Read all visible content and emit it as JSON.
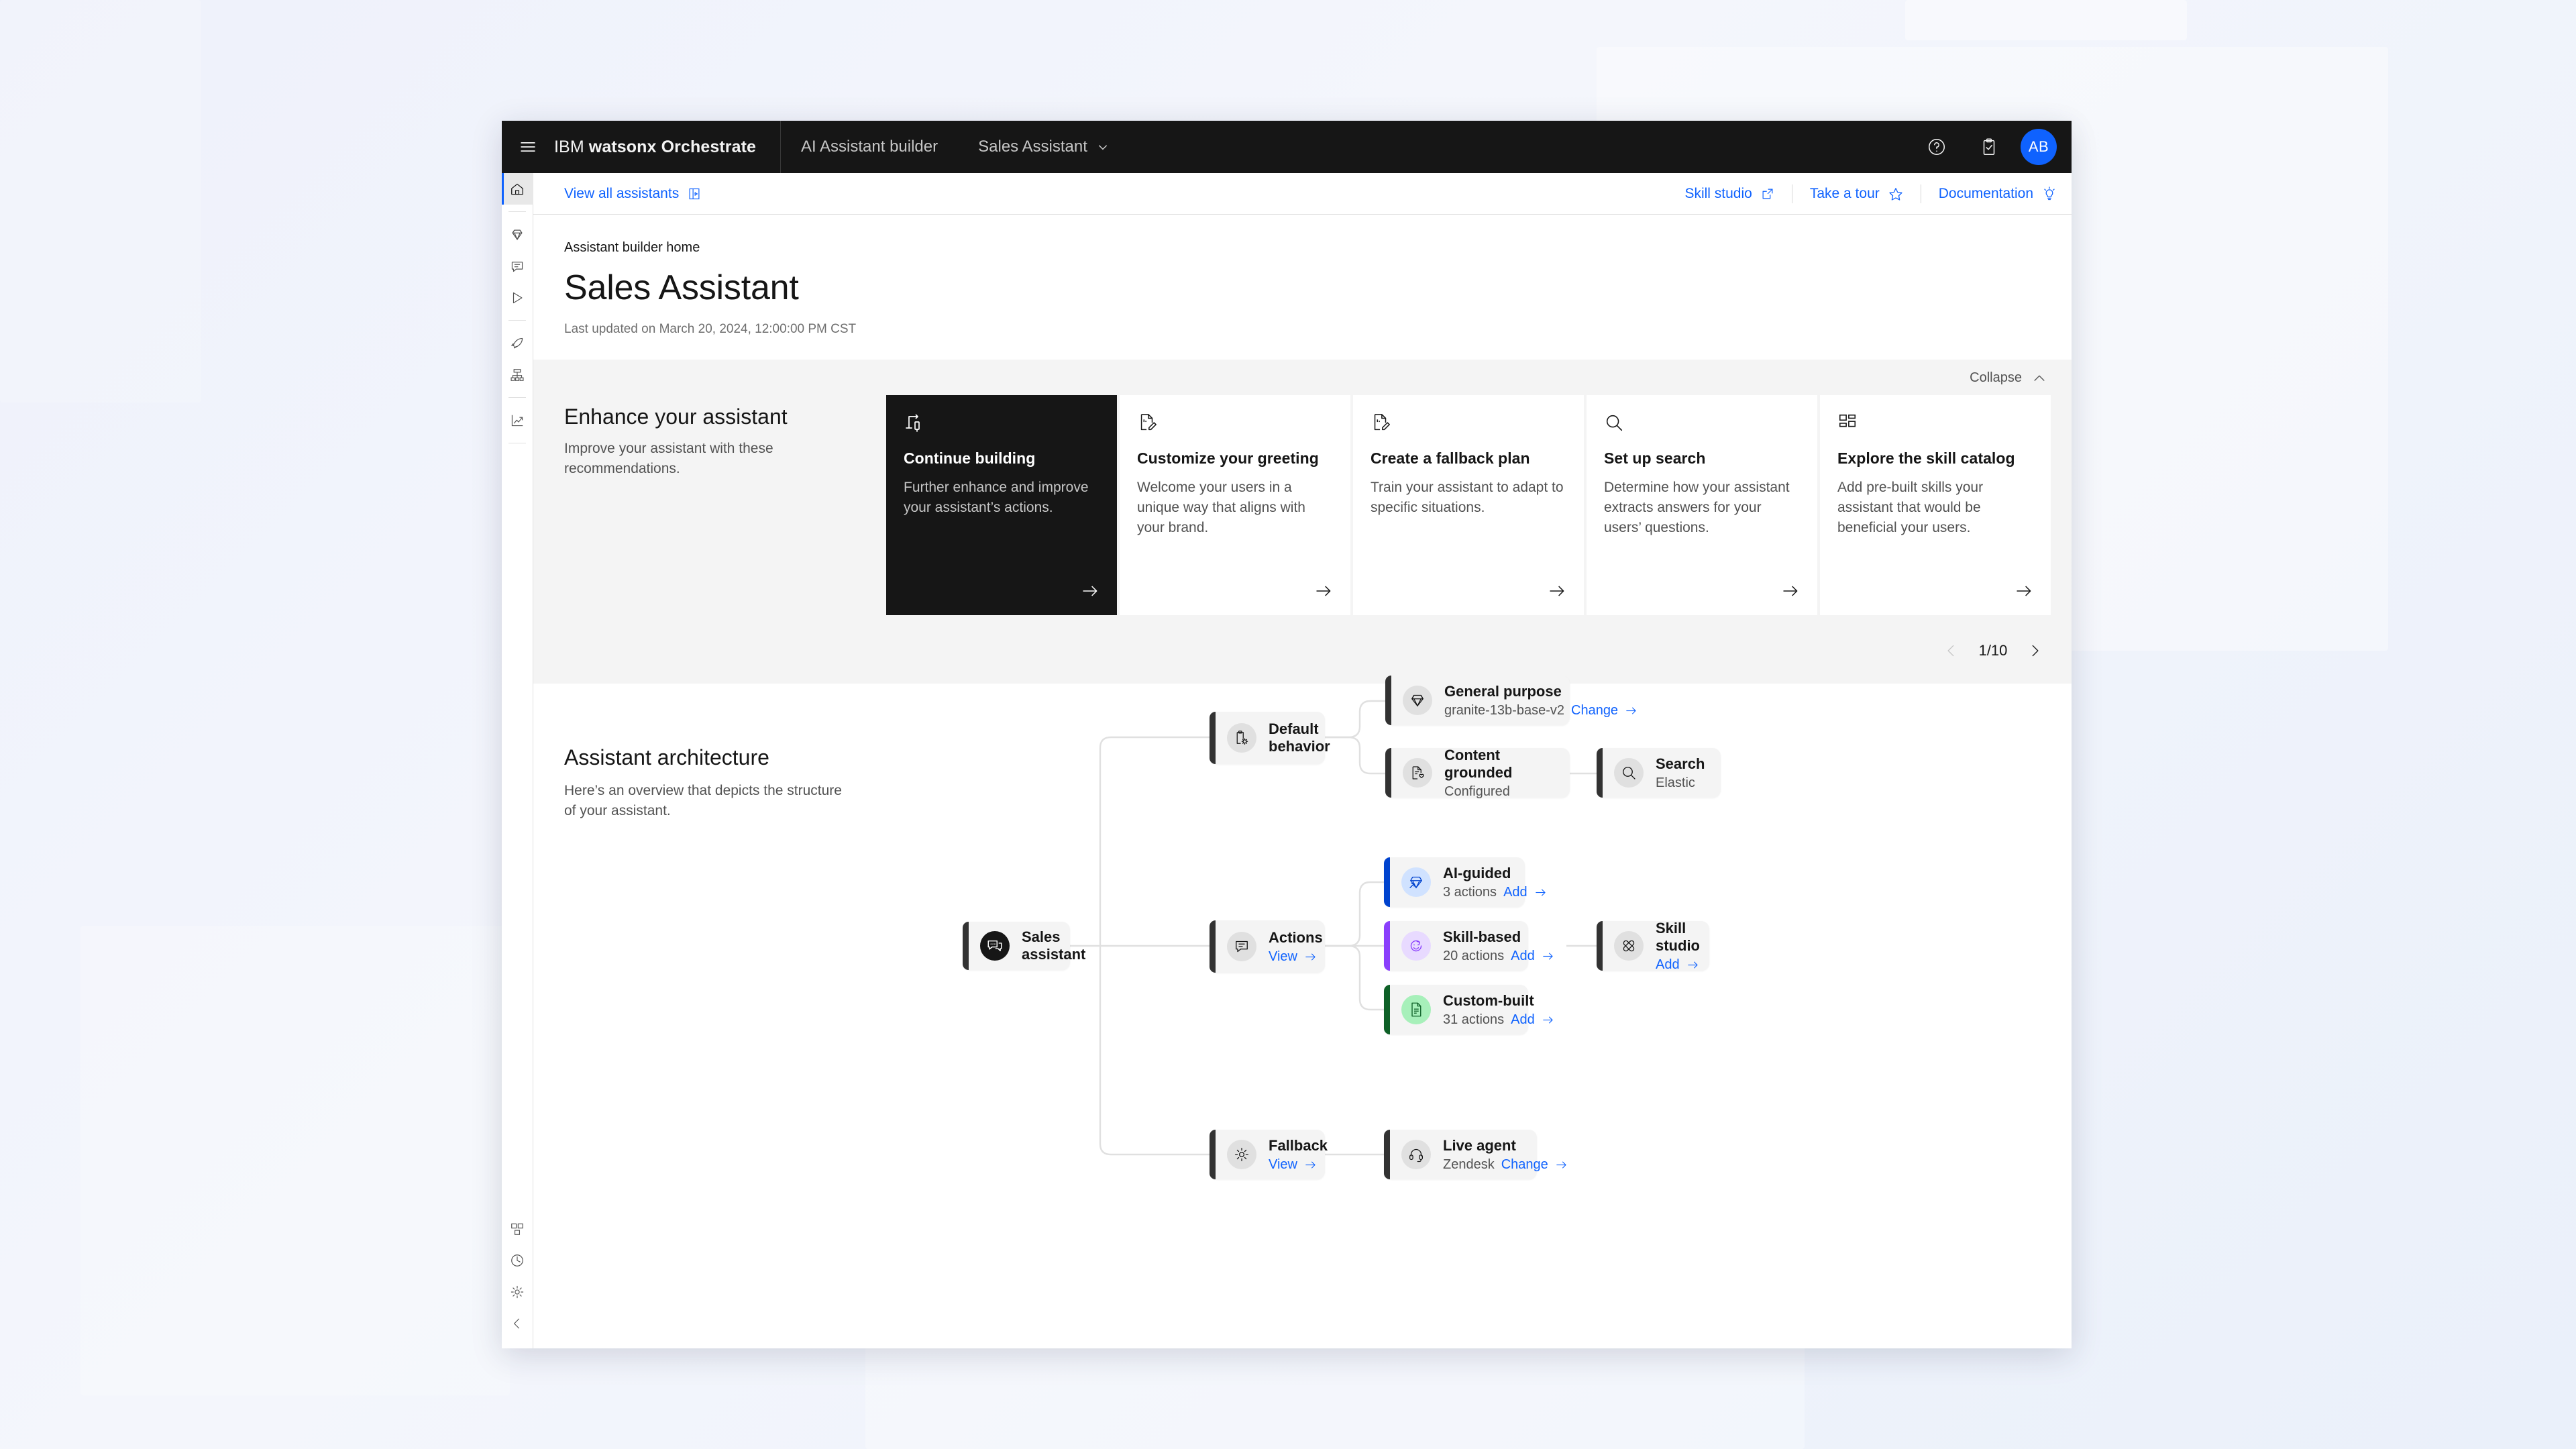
{
  "header": {
    "menu_icon": "hamburger-menu-icon",
    "brand_prefix": "IBM",
    "brand_name": "watsonx Orchestrate",
    "product": "AI Assistant builder",
    "assistant_selector": "Sales Assistant",
    "help_icon": "help-circle-icon",
    "tasks_icon": "clipboard-check-icon",
    "avatar_initials": "AB"
  },
  "rail": {
    "items": [
      {
        "name": "home",
        "icon": "home-icon",
        "active": true
      },
      {
        "name": "divider-1",
        "icon": "divider",
        "active": false
      },
      {
        "name": "diamond",
        "icon": "diamond-icon",
        "active": false
      },
      {
        "name": "chat",
        "icon": "chat-bubble-icon",
        "active": false
      },
      {
        "name": "preview",
        "icon": "play-triangle-icon",
        "active": false
      },
      {
        "name": "divider-2",
        "icon": "divider",
        "active": false
      },
      {
        "name": "deploy",
        "icon": "rocket-icon",
        "active": false
      },
      {
        "name": "integrate",
        "icon": "hierarchy-icon",
        "active": false
      },
      {
        "name": "divider-3",
        "icon": "divider",
        "active": false
      },
      {
        "name": "analytics",
        "icon": "chart-line-icon",
        "active": false
      },
      {
        "name": "divider-4",
        "icon": "divider",
        "active": false
      }
    ],
    "bottom_items": [
      {
        "name": "environments",
        "icon": "model-alt-icon"
      },
      {
        "name": "history",
        "icon": "clock-icon"
      },
      {
        "name": "settings",
        "icon": "gear-icon"
      },
      {
        "name": "collapse",
        "icon": "chevron-left-icon"
      }
    ]
  },
  "toolbar": {
    "view_all": "View all assistants",
    "view_all_icon": "launch-panel-icon",
    "skill_studio": "Skill studio",
    "skill_studio_icon": "external-link-icon",
    "take_a_tour": "Take a tour",
    "take_a_tour_icon": "star-icon",
    "documentation": "Documentation",
    "documentation_icon": "lightbulb-idea-icon"
  },
  "page": {
    "breadcrumb": "Assistant builder home",
    "title": "Sales Assistant",
    "last_updated": "Last updated on March 20, 2024, 12:00:00 PM CST"
  },
  "enhance": {
    "collapse_label": "Collapse",
    "collapse_icon": "chevron-up-icon",
    "heading": "Enhance your assistant",
    "description": "Improve your assistant with these recommendations.",
    "cards": [
      {
        "icon": "flow-connection-icon",
        "title": "Continue building",
        "description": "Further enhance and improve your assistant’s actions.",
        "dark": true
      },
      {
        "icon": "document-edit-icon",
        "title": "Customize your greeting",
        "description": "Welcome your users in a unique way that aligns with your brand.",
        "dark": false
      },
      {
        "icon": "document-edit-icon",
        "title": "Create a fallback plan",
        "description": "Train your assistant to adapt to specific situations.",
        "dark": false
      },
      {
        "icon": "search-icon",
        "title": "Set up search",
        "description": "Determine how your assistant extracts answers for your users’ questions.",
        "dark": false
      },
      {
        "icon": "grid-catalog-icon",
        "title": "Explore the skill catalog",
        "description": "Add pre-built skills your assistant that would be beneficial your users.",
        "dark": false
      }
    ],
    "pager": {
      "prev_icon": "chevron-left-icon",
      "next_icon": "chevron-right-icon",
      "label": "1/10"
    }
  },
  "architecture": {
    "heading": "Assistant architecture",
    "description": "Here’s an overview that depicts the structure of your assistant.",
    "nodes": {
      "root": {
        "title": "Sales assistant",
        "icon": "assistant-chat-icon",
        "sub": "",
        "link": "",
        "link_icon": ""
      },
      "default": {
        "title": "Default behavior",
        "icon": "clipboard-gear-icon",
        "sub": "",
        "link": "",
        "link_icon": ""
      },
      "general": {
        "title": "General purpose",
        "icon": "diamond-icon",
        "sub": "granite-13b-base-v2",
        "link": "Change",
        "link_icon": "arrow-right-icon"
      },
      "content": {
        "title": "Content grounded",
        "icon": "document-heart-icon",
        "sub": "Configured",
        "link": "",
        "link_icon": ""
      },
      "search": {
        "title": "Search",
        "icon": "search-icon",
        "sub": "Elastic",
        "link": "",
        "link_icon": ""
      },
      "actions": {
        "title": "Actions",
        "icon": "chat-bubble-icon",
        "sub": "",
        "link": "View",
        "link_icon": "arrow-right-icon"
      },
      "ai_guided": {
        "title": "AI-guided",
        "icon": "diamond-arrow-icon",
        "sub": "3 actions",
        "link": "Add",
        "link_icon": "arrow-right-icon"
      },
      "skill_based": {
        "title": "Skill-based",
        "icon": "skill-sync-icon",
        "sub": "20 actions",
        "link": "Add",
        "link_icon": "arrow-right-icon"
      },
      "custom_built": {
        "title": "Custom-built",
        "icon": "document-icon",
        "sub": "31 actions",
        "link": "Add",
        "link_icon": "arrow-right-icon"
      },
      "skill_studio": {
        "title": "Skill studio",
        "icon": "skill-cross-icon",
        "sub": "",
        "link": "Add",
        "link_icon": "arrow-right-icon"
      },
      "fallback": {
        "title": "Fallback",
        "icon": "gear-icon",
        "sub": "",
        "link": "View",
        "link_icon": "arrow-right-icon"
      },
      "live_agent": {
        "title": "Live agent",
        "icon": "headset-icon",
        "sub": "Zendesk",
        "link": "Change",
        "link_icon": "arrow-right-icon"
      }
    }
  },
  "colors": {
    "brand_blue": "#0f62fe",
    "dark_blue": "#0043ce",
    "purple": "#8a3ffc",
    "green": "#0e6027",
    "ui_black": "#161616",
    "panel_gray": "#f4f4f4"
  }
}
